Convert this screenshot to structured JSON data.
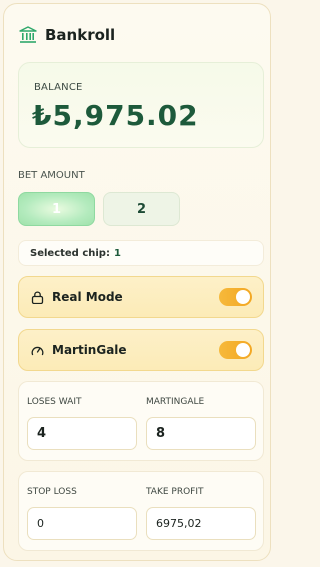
{
  "header": {
    "title": "Bankroll",
    "icon": "bank-icon"
  },
  "balance": {
    "label": "BALANCE",
    "value": "₺5,975.02"
  },
  "bet": {
    "label": "BET AMOUNT",
    "chips": [
      {
        "label": "1",
        "active": true
      },
      {
        "label": "2",
        "active": false
      }
    ],
    "selected_label": "Selected chip:",
    "selected_value": "1"
  },
  "modes": [
    {
      "label": "Real Mode",
      "icon": "lock-icon",
      "enabled": true
    },
    {
      "label": "MartinGale",
      "icon": "gauge-icon",
      "enabled": true
    }
  ],
  "settings": {
    "loses_wait": {
      "label": "LOSES WAIT",
      "value": "4"
    },
    "martingale": {
      "label": "MARTINGALE",
      "value": "8"
    },
    "stop_loss": {
      "label": "STOP LOSS",
      "value": "0"
    },
    "take_profit": {
      "label": "TAKE PROFIT",
      "value": "6975,02"
    }
  },
  "colors": {
    "accent_green": "#1d5a3b",
    "toggle_on": "#f3a722",
    "mode_row_bg": "#fcebb7"
  }
}
